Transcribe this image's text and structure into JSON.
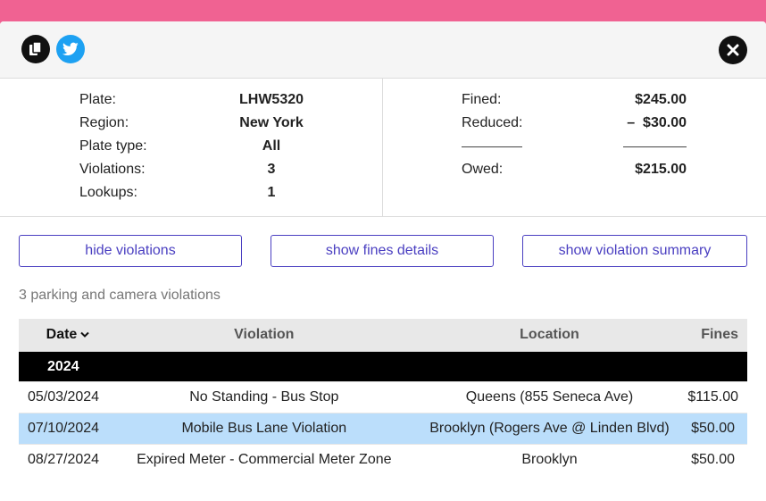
{
  "summary": {
    "plate_label": "Plate:",
    "plate_value": "LHW5320",
    "region_label": "Region:",
    "region_value": "New York",
    "plate_type_label": "Plate type:",
    "plate_type_value": "All",
    "violations_label": "Violations:",
    "violations_value": "3",
    "lookups_label": "Lookups:",
    "lookups_value": "1",
    "fined_label": "Fined:",
    "fined_value": "$245.00",
    "reduced_label": "Reduced:",
    "reduced_value": "–  $30.00",
    "owed_label": "Owed:",
    "owed_value": "$215.00"
  },
  "buttons": {
    "hide_violations": "hide violations",
    "show_fines_details": "show fines details",
    "show_violation_summary": "show violation summary"
  },
  "count_text": "3 parking and camera violations",
  "table": {
    "headers": {
      "date": "Date",
      "violation": "Violation",
      "location": "Location",
      "fines": "Fines"
    },
    "year": "2024",
    "rows": [
      {
        "date": "05/03/2024",
        "violation": "No Standing - Bus Stop",
        "location": "Queens (855 Seneca Ave)",
        "fine": "$115.00"
      },
      {
        "date": "07/10/2024",
        "violation": "Mobile Bus Lane Violation",
        "location": "Brooklyn (Rogers Ave @ Linden Blvd)",
        "fine": "$50.00"
      },
      {
        "date": "08/27/2024",
        "violation": "Expired Meter - Commercial Meter Zone",
        "location": "Brooklyn",
        "fine": "$50.00"
      }
    ]
  },
  "colors": {
    "page_bg": "#f06292",
    "accent": "#4a3fc1",
    "highlight_row": "#bbdefb",
    "twitter": "#1da1f2"
  },
  "icons": [
    "copy-icon",
    "twitter-icon",
    "close-icon",
    "chevron-down-icon"
  ]
}
